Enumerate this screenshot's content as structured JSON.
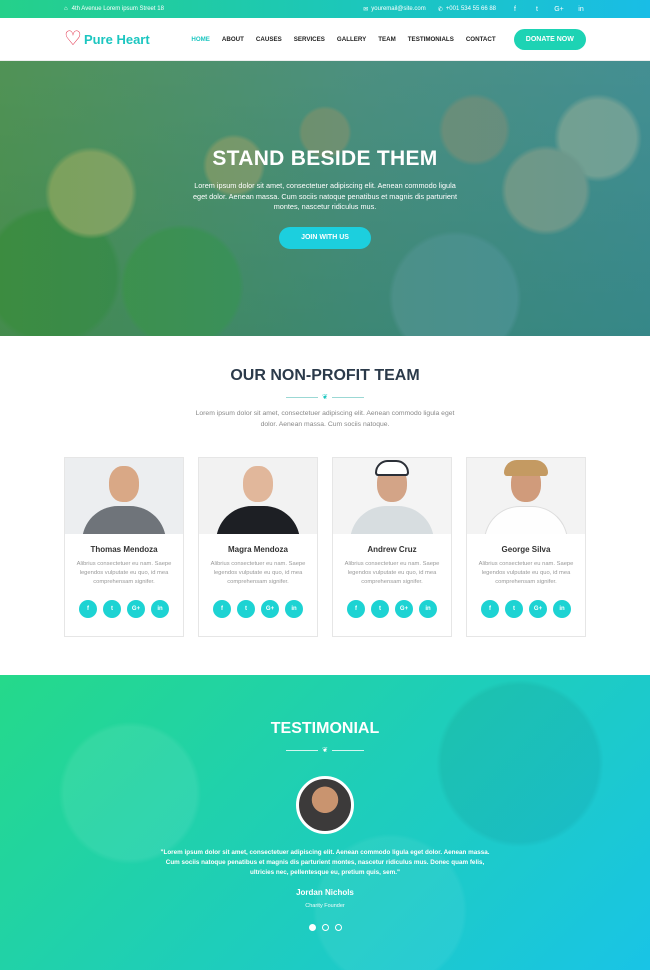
{
  "topbar": {
    "address": "4th Avenue Lorem ipsum Street 18",
    "email": "youremail@site.com",
    "phone": "+001 534 55 66 88",
    "social": [
      {
        "icon": "facebook-icon",
        "glyph": "f"
      },
      {
        "icon": "twitter-icon",
        "glyph": "t"
      },
      {
        "icon": "google-plus-icon",
        "glyph": "G+"
      },
      {
        "icon": "linkedin-icon",
        "glyph": "in"
      }
    ]
  },
  "header": {
    "logo_text": "Pure Heart",
    "nav": [
      "HOME",
      "ABOUT",
      "CAUSES",
      "SERVICES",
      "GALLERY",
      "TEAM",
      "TESTIMONIALS",
      "CONTACT"
    ],
    "active_nav": "HOME",
    "donate_label": "DONATE NOW"
  },
  "hero": {
    "title": "STAND BESIDE THEM",
    "text": "Lorem ipsum dolor sit amet, consectetuer adipiscing elit. Aenean commodo ligula eget dolor. Aenean massa. Cum sociis natoque penatibus et magnis dis parturient montes, nascetur ridiculus mus.",
    "button": "JOIN WITH US"
  },
  "team": {
    "title": "OUR NON-PROFIT TEAM",
    "desc": "Lorem ipsum dolor sit amet, consectetuer adipiscing elit. Aenean commodo ligula eget dolor. Aenean massa. Cum sociis natoque.",
    "members": [
      {
        "name": "Thomas Mendoza",
        "text": "Alibrius consectetuer eu nam. Saepe legendos vulputate eu quo, id mea comprehensam signifer."
      },
      {
        "name": "Magra Mendoza",
        "text": "Alibrius consectetuer eu nam. Saepe legendos vulputate eu quo, id mea comprehensam signifer."
      },
      {
        "name": "Andrew Cruz",
        "text": "Alibrius consectetuer eu nam. Saepe legendos vulputate eu quo, id mea comprehensam signifer."
      },
      {
        "name": "George Silva",
        "text": "Alibrius consectetuer eu nam. Saepe legendos vulputate eu quo, id mea comprehensam signifer."
      }
    ],
    "card_social": [
      "f",
      "t",
      "G+",
      "in"
    ]
  },
  "testimonial": {
    "title": "TESTIMONIAL",
    "quote": "\"Lorem ipsum dolor sit amet, consectetuer adipiscing elit. Aenean commodo ligula eget dolor. Aenean massa. Cum sociis natoque penatibus et magnis dis parturient montes, nascetur ridiculus mus. Donec quam felis, ultricies nec, pellentesque eu, pretium quis, sem.\"",
    "author": "Jordan Nichols",
    "role": "Charity Founder"
  },
  "colors": {
    "accent": "#1cc6c0",
    "gradient_start": "#25d98a",
    "gradient_end": "#19c4e6"
  }
}
